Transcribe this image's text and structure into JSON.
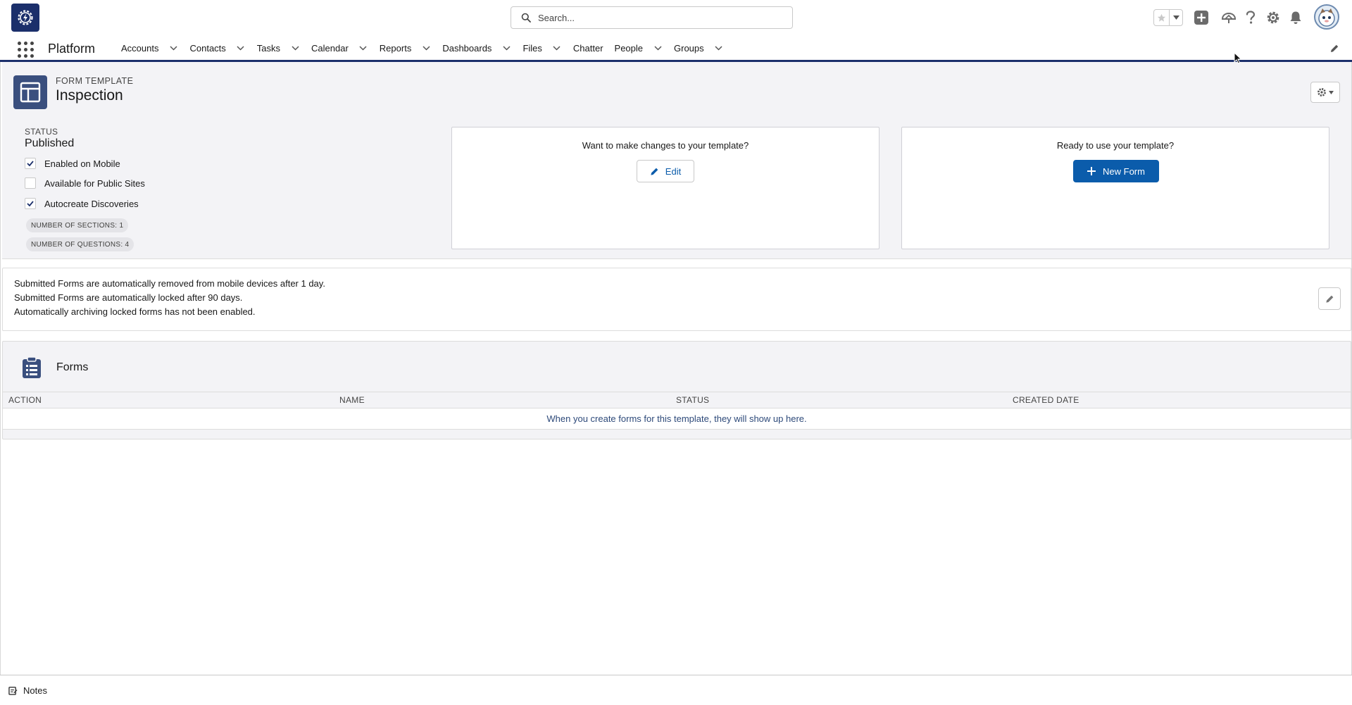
{
  "header": {
    "search": {
      "placeholder": "Search..."
    },
    "icons": [
      "favorites-star-icon",
      "add-icon",
      "trailhead-icon",
      "help-icon",
      "setup-gear-icon",
      "notifications-bell-icon",
      "user-avatar"
    ]
  },
  "nav": {
    "app_name": "Platform",
    "items": [
      {
        "label": "Accounts",
        "dropdown": true
      },
      {
        "label": "Contacts",
        "dropdown": true
      },
      {
        "label": "Tasks",
        "dropdown": true
      },
      {
        "label": "Calendar",
        "dropdown": true
      },
      {
        "label": "Reports",
        "dropdown": true
      },
      {
        "label": "Dashboards",
        "dropdown": true
      },
      {
        "label": "Files",
        "dropdown": true
      },
      {
        "label": "Chatter",
        "dropdown": false
      },
      {
        "label": "People",
        "dropdown": true
      },
      {
        "label": "Groups",
        "dropdown": true
      }
    ]
  },
  "record": {
    "type_label": "FORM TEMPLATE",
    "title": "Inspection",
    "status_label": "STATUS",
    "status_value": "Published",
    "checkboxes": [
      {
        "label": "Enabled on Mobile",
        "checked": true
      },
      {
        "label": "Available for Public Sites",
        "checked": false
      },
      {
        "label": "Autocreate Discoveries",
        "checked": true
      }
    ],
    "sections_pill": "NUMBER OF SECTIONS: 1",
    "questions_pill": "NUMBER OF QUESTIONS: 4"
  },
  "edit_panel": {
    "prompt": "Want to make changes to your template?",
    "button": "Edit"
  },
  "use_panel": {
    "prompt": "Ready to use your template?",
    "button": "New Form"
  },
  "info": {
    "lines": [
      "Submitted Forms are automatically removed from mobile devices after 1 day.",
      "Submitted Forms are automatically locked after 90 days.",
      "Automatically archiving locked forms has not been enabled."
    ]
  },
  "forms": {
    "title": "Forms",
    "columns": [
      "ACTION",
      "NAME",
      "STATUS",
      "CREATED DATE"
    ],
    "empty_message": "When you create forms for this template, they will show up here."
  },
  "footer": {
    "notes_label": "Notes"
  },
  "colors": {
    "brand_navy": "#1b2f6b",
    "brand_blue": "#0b5cab",
    "card_bg": "#f3f3f6",
    "record_icon": "#3a4f7e"
  }
}
